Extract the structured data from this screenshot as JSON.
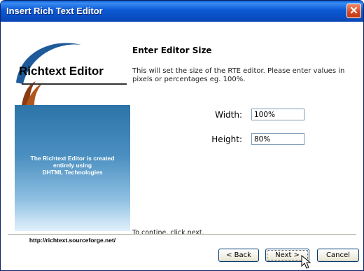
{
  "window": {
    "title": "Insert Rich Text Editor"
  },
  "sidebar": {
    "logo_text": "Richtext Editor",
    "tagline_lines": [
      "The Richtext Editor is created",
      "entirely using",
      "DHTML Technologies"
    ],
    "url": "http://richtext.sourceforge.net/"
  },
  "main": {
    "heading": "Enter Editor Size",
    "description": "This will set the size of the RTE editor. Please enter values in pixels or percentages eg. 100%.",
    "width_label": "Width:",
    "width_value": "100%",
    "height_label": "Height:",
    "height_value": "80%",
    "continue_text": "To contine, click next."
  },
  "buttons": {
    "back": "< Back",
    "next": "Next >",
    "cancel": "Cancel"
  },
  "icons": {
    "close": "close-icon",
    "cursor": "mouse-pointer-icon"
  },
  "colors": {
    "titlebar": "#0a4fc4",
    "close_button": "#d6471f",
    "logo_swoosh_blue": "#1f5a9a",
    "logo_swoosh_brown": "#8a3b12"
  }
}
